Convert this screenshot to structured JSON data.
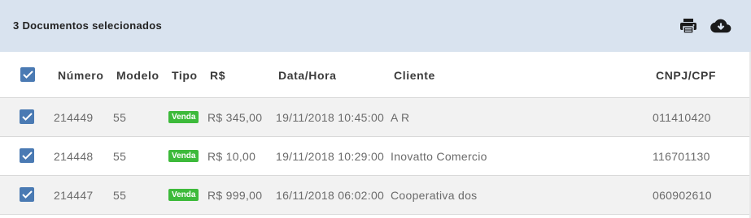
{
  "selection": {
    "text": "3 Documentos selecionados",
    "actions": [
      {
        "name": "print-icon"
      },
      {
        "name": "cloud-download-icon"
      }
    ]
  },
  "table": {
    "columns": [
      "Número",
      "Modelo",
      "Tipo",
      "R$",
      "Data/Hora",
      "Cliente",
      "CNPJ/CPF"
    ],
    "header_checked": true,
    "rows": [
      {
        "checked": true,
        "numero": "214449",
        "modelo": "55",
        "tipo": "Venda",
        "valor": "R$ 345,00",
        "data_hora": "19/11/2018 10:45:00",
        "cliente": "A R",
        "cnpj_cpf": "011410420"
      },
      {
        "checked": true,
        "numero": "214448",
        "modelo": "55",
        "tipo": "Venda",
        "valor": "R$ 10,00",
        "data_hora": "19/11/2018 10:29:00",
        "cliente": "Inovatto Comercio",
        "cnpj_cpf": "116701130"
      },
      {
        "checked": true,
        "numero": "214447",
        "modelo": "55",
        "tipo": "Venda",
        "valor": "R$ 999,00",
        "data_hora": "16/11/2018 06:02:00",
        "cliente": "Cooperativa dos",
        "cnpj_cpf": "060902610"
      }
    ]
  },
  "colors": {
    "selection_bar": "#d9e3ef",
    "checkbox": "#4a7ab3",
    "badge": "#3dba3b"
  }
}
